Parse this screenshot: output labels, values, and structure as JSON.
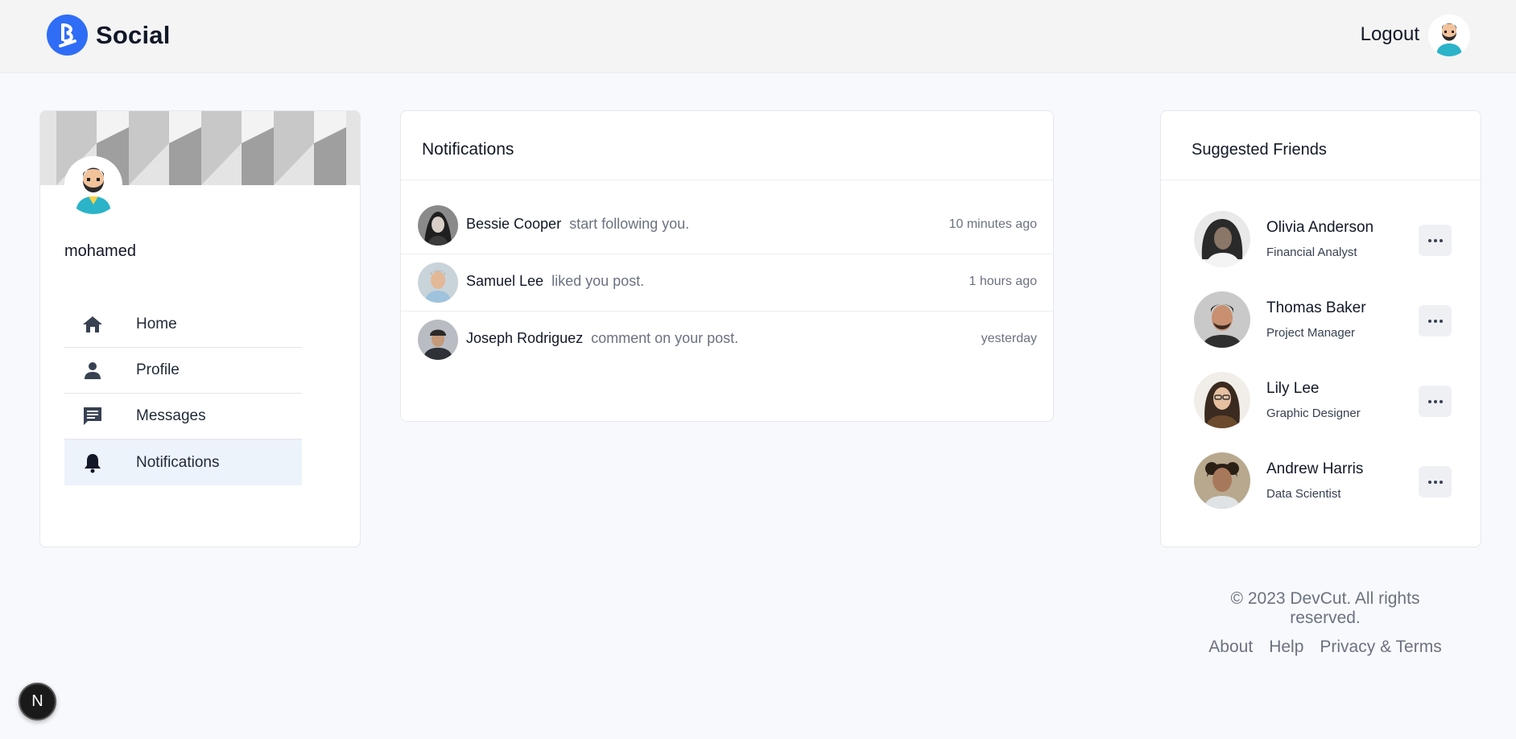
{
  "header": {
    "brand_name": "Social",
    "logout_label": "Logout",
    "brand_color": "#2f6df6"
  },
  "profile": {
    "username": "mohamed",
    "nav": [
      {
        "label": "Home",
        "icon": "home-icon"
      },
      {
        "label": "Profile",
        "icon": "person-icon"
      },
      {
        "label": "Messages",
        "icon": "message-icon"
      },
      {
        "label": "Notifications",
        "icon": "bell-icon",
        "active": true
      }
    ]
  },
  "notifications": {
    "title": "Notifications",
    "items": [
      {
        "name": "Bessie Cooper",
        "text": "start following you.",
        "time": "10 minutes ago"
      },
      {
        "name": "Samuel Lee",
        "text": "liked you post.",
        "time": "1 hours ago"
      },
      {
        "name": "Joseph Rodriguez",
        "text": "comment on your post.",
        "time": "yesterday"
      }
    ]
  },
  "friends": {
    "title": "Suggested Friends",
    "items": [
      {
        "name": "Olivia Anderson",
        "role": "Financial Analyst"
      },
      {
        "name": "Thomas Baker",
        "role": "Project Manager"
      },
      {
        "name": "Lily Lee",
        "role": "Graphic Designer"
      },
      {
        "name": "Andrew Harris",
        "role": "Data Scientist"
      }
    ]
  },
  "footer": {
    "copyright": "© 2023 DevCut. All rights reserved.",
    "links": [
      "About",
      "Help",
      "Privacy & Terms"
    ]
  },
  "dev_badge": {
    "label": "N"
  }
}
